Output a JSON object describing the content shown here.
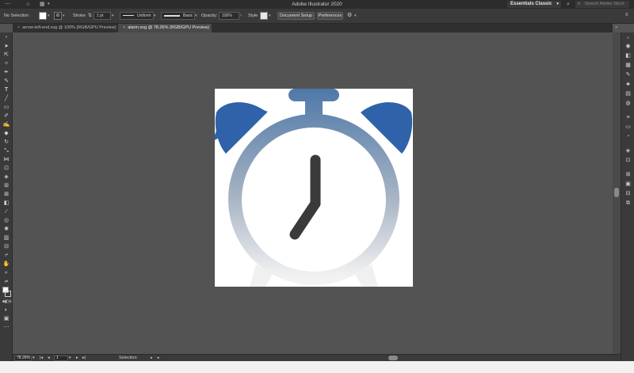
{
  "titlebar": {
    "app_title": "Adobe Illustrator 2020",
    "workspace": "Essentials Classic",
    "search_placeholder": "Search Adobe Stock"
  },
  "controlbar": {
    "selection_label": "No Selection",
    "stroke_label": "Stroke",
    "stroke_weight": "1 pt",
    "profile_uniform": "Uniform",
    "brush_basic": "Basic",
    "opacity_label": "Opacity:",
    "opacity_value": "100%",
    "style_label": "Style",
    "document_setup": "Document Setup",
    "preferences": "Preferences"
  },
  "tabs": [
    {
      "label": "arrow-left-end.svg @ 100% (RGB/GPU Preview)",
      "active": false
    },
    {
      "label": "alarm.svg @ 78.26% (RGB/GPU Preview)",
      "active": true
    }
  ],
  "statusbar": {
    "zoom": "78.26%",
    "artboard_number": "1",
    "tool_status": "Selection"
  },
  "colors": {
    "bell_blue": "#2f62a8",
    "gradient_top": "#4f78a8",
    "gradient_bottom": "#f2f2f2",
    "hand_color": "#3a3a3a",
    "canvas": "#535353"
  }
}
